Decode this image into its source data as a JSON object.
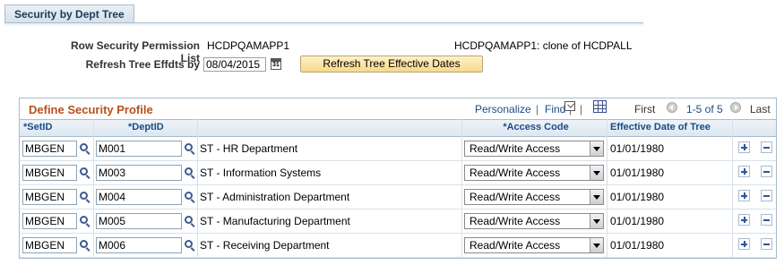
{
  "tab": {
    "label": "Security by Dept Tree"
  },
  "form": {
    "perm_list_label": "Row Security Permission List",
    "perm_list_value": "HCDPQAMAPP1",
    "perm_list_desc": "HCDPQAMAPP1:  clone of HCDPALL",
    "refresh_label": "Refresh Tree Effdts by",
    "refresh_date": "08/04/2015",
    "refresh_button": "Refresh Tree Effective Dates"
  },
  "grid": {
    "title": "Define Security Profile",
    "nav": {
      "personalize": "Personalize",
      "sep": "|",
      "find": "Find",
      "first": "First",
      "range": "1-5 of 5",
      "last": "Last"
    },
    "columns": {
      "setid": "*SetID",
      "deptid": "*DeptID",
      "access": "*Access Code",
      "effdt": "Effective Date of Tree"
    },
    "rows": [
      {
        "setid": "MBGEN",
        "deptid": "M001",
        "desc": "ST - HR Department",
        "access": "Read/Write Access",
        "effdt": "01/01/1980"
      },
      {
        "setid": "MBGEN",
        "deptid": "M003",
        "desc": "ST - Information Systems",
        "access": "Read/Write Access",
        "effdt": "01/01/1980"
      },
      {
        "setid": "MBGEN",
        "deptid": "M004",
        "desc": "ST - Administration Department",
        "access": "Read/Write Access",
        "effdt": "01/01/1980"
      },
      {
        "setid": "MBGEN",
        "deptid": "M005",
        "desc": "ST - Manufacturing Department",
        "access": "Read/Write Access",
        "effdt": "01/01/1980"
      },
      {
        "setid": "MBGEN",
        "deptid": "M006",
        "desc": "ST - Receiving Department",
        "access": "Read/Write Access",
        "effdt": "01/01/1980"
      }
    ]
  },
  "icons": {
    "lookup": "magnifier-icon",
    "calendar": "calendar-icon",
    "zoom": "zoom-icon",
    "download": "download-icon",
    "add": "plus-icon",
    "delete": "minus-icon"
  },
  "colors": {
    "grid_title": "#b8501a",
    "link": "#1a4b88",
    "button_bg": "#f6d98a"
  }
}
